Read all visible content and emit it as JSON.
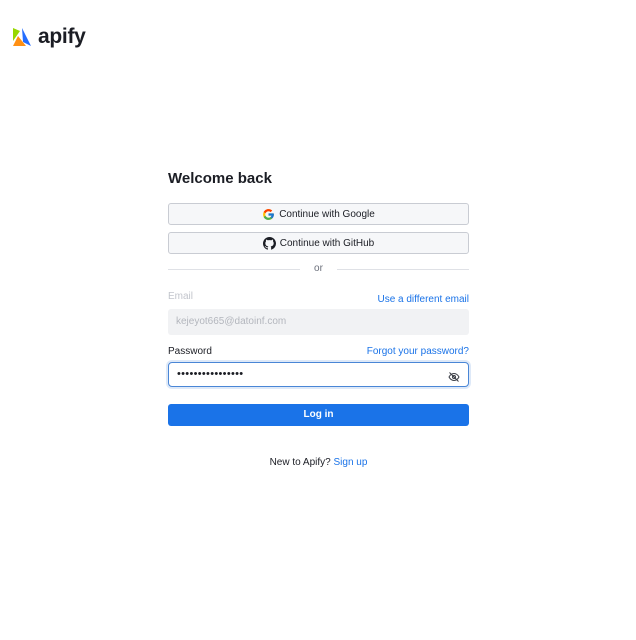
{
  "brand": {
    "name": "apify",
    "icon": "apify-logo-icon",
    "colors": {
      "blue": "#246DFF",
      "green": "#97D700",
      "orange": "#FF9013"
    }
  },
  "login": {
    "title": "Welcome back",
    "google_label": "Continue with Google",
    "github_label": "Continue with GitHub",
    "divider_text": "or",
    "email_label": "Email",
    "use_different_email": "Use a different email",
    "email_value": "kejeyot665@datoinf.com",
    "password_label": "Password",
    "forgot_password": "Forgot your password?",
    "password_masked": "••••••••••••••••",
    "password_visibility_icon": "eye-off-icon",
    "login_label": "Log in",
    "signup_prompt": "New to Apify?",
    "signup_link": "Sign up"
  },
  "colors": {
    "accent": "#1a73e8",
    "focus_border": "#4a86d6",
    "text": "#1b1d24"
  }
}
